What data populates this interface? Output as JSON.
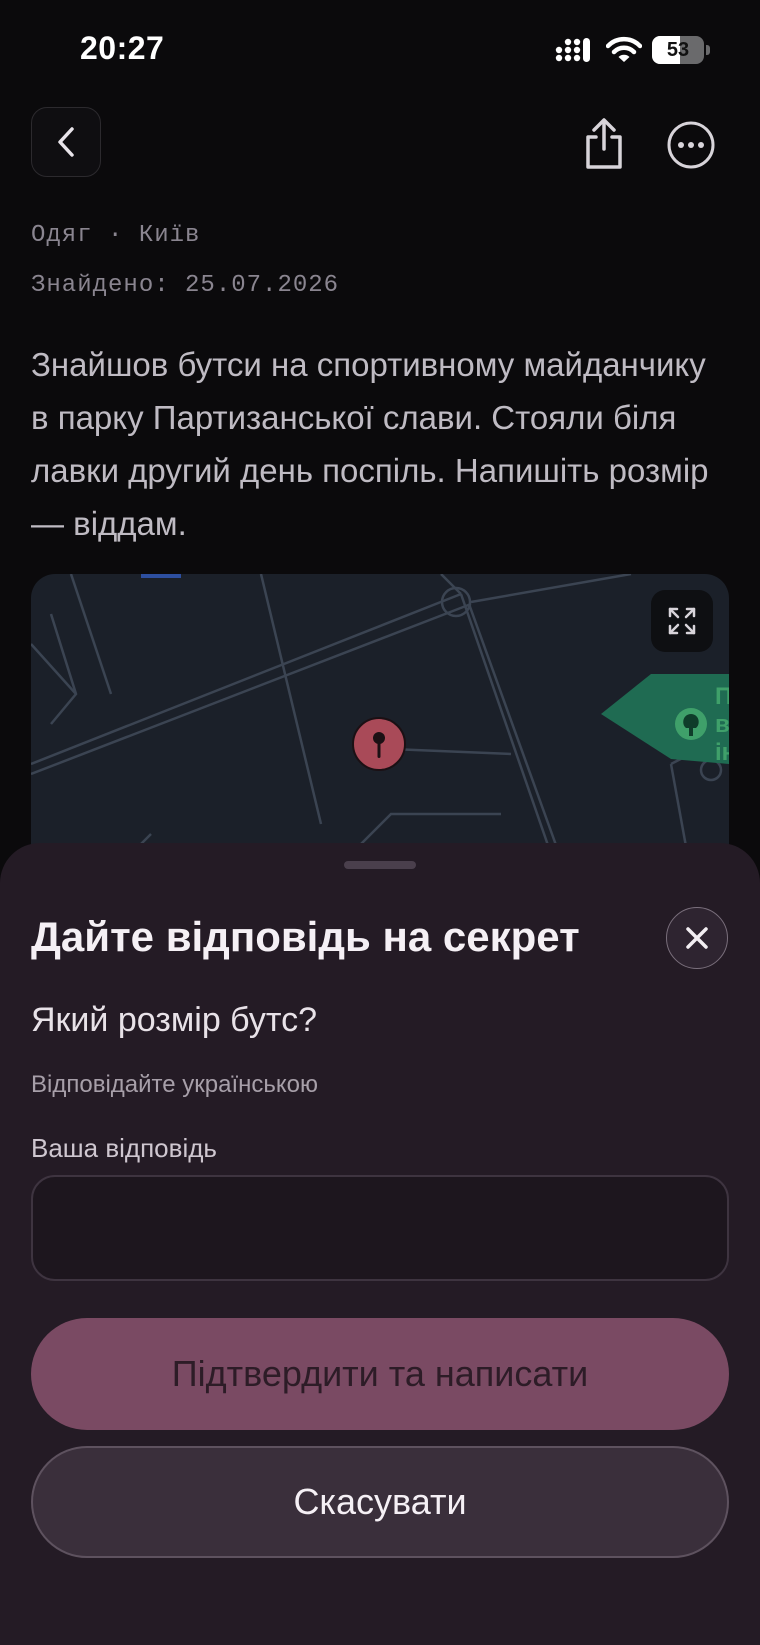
{
  "status_bar": {
    "time": "20:27",
    "battery_percent": 53
  },
  "header": {
    "back_icon": "chevron-left-icon",
    "share_icon": "share-icon",
    "more_icon": "more-horizontal-icon"
  },
  "item": {
    "category_location": "Одяг · Київ",
    "found_date": "Знайдено: 25.07.2026",
    "description": "Знайшов бутси на спортивному майданчику в парку Партизанської слави. Стояли біля лавки другий день поспіль. Напишіть розмір — віддам."
  },
  "map": {
    "expand_icon": "expand-icon",
    "pin_icon": "map-pin-icon",
    "park_color": "#1f6b52",
    "pin_color": "#a94a58"
  },
  "sheet": {
    "title": "Дайте відповідь на секрет",
    "close_icon": "close-icon",
    "question": "Який розмір бутс?",
    "hint": "Відповідайте українською",
    "field_label": "Ваша відповідь",
    "answer_value": "",
    "confirm_label": "Підтвердити та написати",
    "cancel_label": "Скасувати",
    "accent_color": "#7a4a63"
  }
}
